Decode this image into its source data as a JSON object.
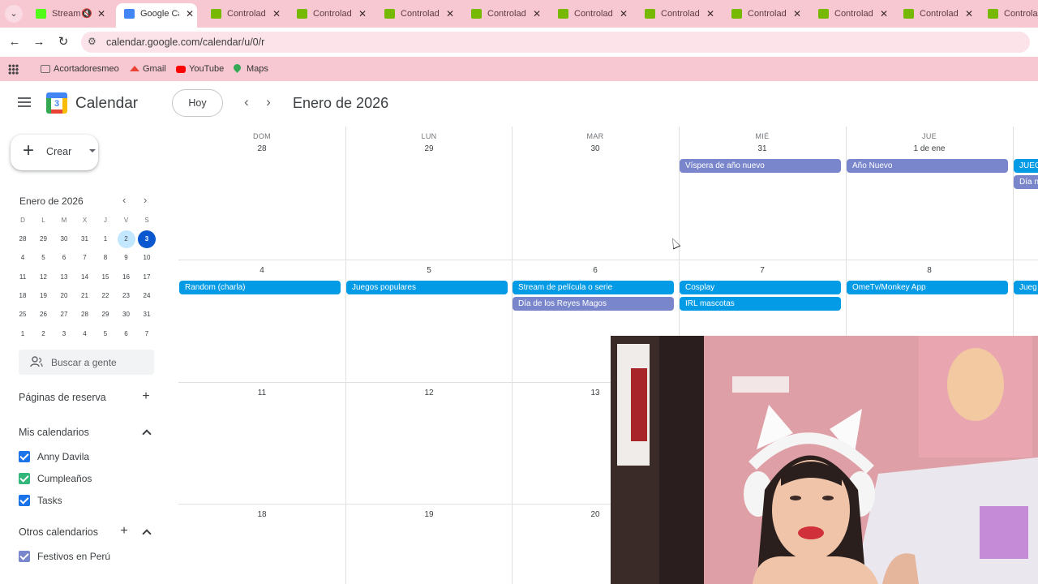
{
  "browser": {
    "tabs": [
      {
        "title": "Stream",
        "type": "stream",
        "muted": true
      },
      {
        "title": "Google Ca",
        "type": "calendar",
        "active": true
      },
      {
        "title": "Controlad",
        "type": "nvidia"
      },
      {
        "title": "Controlad",
        "type": "nvidia"
      },
      {
        "title": "Controlad",
        "type": "nvidia"
      },
      {
        "title": "Controlad",
        "type": "nvidia"
      },
      {
        "title": "Controlad",
        "type": "nvidia"
      },
      {
        "title": "Controlad",
        "type": "nvidia"
      },
      {
        "title": "Controlad",
        "type": "nvidia"
      },
      {
        "title": "Controlad",
        "type": "nvidia"
      },
      {
        "title": "Controlad",
        "type": "nvidia"
      },
      {
        "title": "Controlad",
        "type": "nvidia"
      }
    ],
    "url": "calendar.google.com/calendar/u/0/r",
    "bookmarks": [
      {
        "label": "Acortadoresmeo",
        "icon": "folder-icon"
      },
      {
        "label": "Gmail",
        "icon": "gmail-icon"
      },
      {
        "label": "YouTube",
        "icon": "youtube-icon"
      },
      {
        "label": "Maps",
        "icon": "maps-icon"
      }
    ]
  },
  "header": {
    "app_title": "Calendar",
    "logo_number": "3",
    "today_label": "Hoy",
    "month_title": "Enero de 2026"
  },
  "sidebar": {
    "create_label": "Crear",
    "mini_calendar": {
      "title": "Enero de 2026",
      "weekdays": [
        "D",
        "L",
        "M",
        "X",
        "J",
        "V",
        "S"
      ],
      "weeks": [
        [
          "28",
          "29",
          "30",
          "31",
          "1",
          "2",
          "3"
        ],
        [
          "4",
          "5",
          "6",
          "7",
          "8",
          "9",
          "10"
        ],
        [
          "11",
          "12",
          "13",
          "14",
          "15",
          "16",
          "17"
        ],
        [
          "18",
          "19",
          "20",
          "21",
          "22",
          "23",
          "24"
        ],
        [
          "25",
          "26",
          "27",
          "28",
          "29",
          "30",
          "31"
        ],
        [
          "1",
          "2",
          "3",
          "4",
          "5",
          "6",
          "7"
        ]
      ],
      "selected_day": "2",
      "today": "3"
    },
    "search_people": "Buscar a gente",
    "booking_pages": "Páginas de reserva",
    "my_calendars_title": "Mis calendarios",
    "my_calendars": [
      {
        "label": "Anny Davila",
        "color": "#1a73e8"
      },
      {
        "label": "Cumpleaños",
        "color": "#33b679"
      },
      {
        "label": "Tasks",
        "color": "#1a73e8"
      }
    ],
    "other_calendars_title": "Otros calendarios",
    "other_calendars": [
      {
        "label": "Festivos en Perú",
        "color": "#7986cb"
      }
    ]
  },
  "month_view": {
    "weekdays": [
      "DOM",
      "LUN",
      "MAR",
      "MIÉ",
      "JUE"
    ],
    "weeks": [
      {
        "days": [
          "28",
          "29",
          "30",
          "31",
          "1 de ene"
        ],
        "events": [
          {
            "day": 3,
            "title": "Víspera de año nuevo",
            "color": "purple",
            "slot": 0
          },
          {
            "day": 4,
            "title": "Año Nuevo",
            "color": "purple",
            "slot": 0
          },
          {
            "day": 5,
            "title": "JUEG",
            "color": "blue",
            "slot": 0
          },
          {
            "day": 5,
            "title": "Día n",
            "color": "purple",
            "slot": 1
          }
        ]
      },
      {
        "days": [
          "4",
          "5",
          "6",
          "7",
          "8"
        ],
        "events": [
          {
            "day": 0,
            "title": "Random (charla)",
            "color": "blue",
            "slot": 0
          },
          {
            "day": 1,
            "title": "Juegos populares",
            "color": "blue",
            "slot": 0
          },
          {
            "day": 2,
            "title": "Stream de película o serie",
            "color": "blue",
            "slot": 0
          },
          {
            "day": 2,
            "title": "Día de los Reyes Magos",
            "color": "purple",
            "slot": 1
          },
          {
            "day": 3,
            "title": "Cosplay",
            "color": "blue",
            "slot": 0
          },
          {
            "day": 3,
            "title": "IRL mascotas",
            "color": "blue",
            "slot": 1
          },
          {
            "day": 4,
            "title": "OmeTv/Monkey App",
            "color": "blue",
            "slot": 0
          },
          {
            "day": 5,
            "title": "Jueg",
            "color": "blue",
            "slot": 0
          }
        ]
      },
      {
        "days": [
          "11",
          "12",
          "13",
          "",
          ""
        ],
        "events": []
      },
      {
        "days": [
          "18",
          "19",
          "20",
          "",
          ""
        ],
        "events": []
      }
    ]
  },
  "colors": {
    "event_blue": "#039be5",
    "event_purple": "#7986cb",
    "today_blue": "#0b57d0",
    "chrome_pink": "#f7c7d2"
  }
}
